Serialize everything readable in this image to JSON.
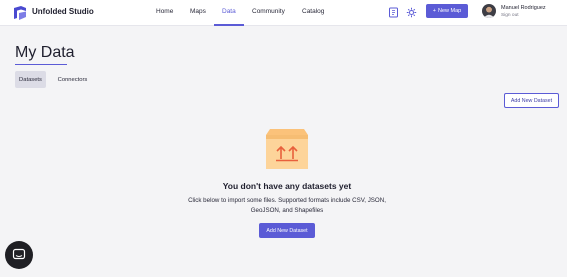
{
  "header": {
    "brand": "Unfolded Studio",
    "logo_icon": "unfolded-logo-icon",
    "nav": [
      {
        "label": "Home",
        "active": false
      },
      {
        "label": "Maps",
        "active": false
      },
      {
        "label": "Data",
        "active": true
      },
      {
        "label": "Community",
        "active": false
      },
      {
        "label": "Catalog",
        "active": false
      }
    ],
    "tool_icons": [
      "docs-icon",
      "settings-icon"
    ],
    "new_map_label": "New Map",
    "new_map_icon": "plus-icon",
    "user": {
      "name": "Manuel Rodriguez",
      "sign_out": "Sign out"
    }
  },
  "page": {
    "title": "My Data",
    "tabs": [
      {
        "label": "Datasets",
        "active": true
      },
      {
        "label": "Connectors",
        "active": false
      }
    ],
    "add_dataset_label": "Add New Dataset"
  },
  "empty_state": {
    "illustration": "open-box-upload-icon",
    "title": "You don't have any datasets yet",
    "description": "Click below to import some files. Supported formats include CSV, JSON, GeoJSON, and Shapefiles",
    "button_label": "Add New Dataset"
  },
  "chat": {
    "icon": "chat-icon"
  },
  "colors": {
    "accent": "#5b5bd6",
    "background": "#f4f4f6",
    "box": "#fdd49a",
    "arrow": "#e8603c"
  }
}
